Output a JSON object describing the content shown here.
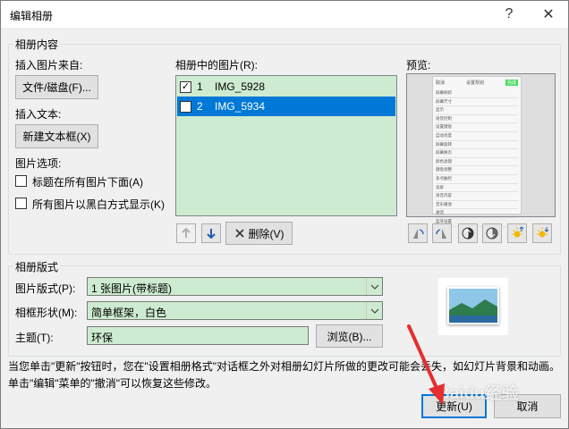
{
  "window": {
    "title": "编辑相册",
    "help_label": "?",
    "close_label": "✕"
  },
  "content_group": {
    "label": "相册内容",
    "insert_from_label": "插入图片来自:",
    "file_button": "文件/磁盘(F)...",
    "insert_text_label": "插入文本:",
    "new_textbox_button": "新建文本框(X)",
    "picture_options_label": "图片选项:",
    "option_captions": {
      "label": "标题在所有图片下面(A)",
      "checked": false
    },
    "option_bw": {
      "label": "所有图片以黑白方式显示(K)",
      "checked": false
    },
    "pictures_label": "相册中的图片(R):",
    "pictures": [
      {
        "num": "1",
        "name": "IMG_5928",
        "checked": true,
        "selected": false
      },
      {
        "num": "2",
        "name": "IMG_5934",
        "checked": false,
        "selected": true
      }
    ],
    "delete_button": "删除(V)",
    "preview_label": "预览:"
  },
  "preview_phone": {
    "header_left": "取消",
    "header_title": "设置规划",
    "header_right": "完成",
    "items": [
      "屏幕刷新",
      "屏幕尺寸",
      "显示",
      "语音控制",
      "设置键盘",
      "自动亮度",
      "屏幕旋转",
      "屏幕换页",
      "颜色滤镜",
      "键盘调整",
      "多点触控",
      "读屏",
      "语音内容",
      "音乐播放",
      "通话",
      "蓝牙设置"
    ]
  },
  "layout_group": {
    "label": "相册版式",
    "picture_layout_label": "图片版式(P):",
    "picture_layout_value": "1 张图片(带标题)",
    "frame_shape_label": "相框形状(M):",
    "frame_shape_value": "简单框架，白色",
    "theme_label": "主题(T):",
    "theme_value": "环保",
    "browse_button": "浏览(B)..."
  },
  "info_text": "当您单击\"更新\"按钮时，您在\"设置相册格式\"对话框之外对相册幻灯片所做的更改可能会丢失，如幻灯片背景和动画。单击\"编辑\"菜单的\"撤消\"可以恢复这些修改。",
  "footer": {
    "update_button": "更新(U)",
    "cancel_button": "取消"
  },
  "watermark": "Baidu经验",
  "colors": {
    "list_bg": "#cdebd0",
    "selection": "#0078d7",
    "annotation_arrow": "#e52e2e"
  }
}
